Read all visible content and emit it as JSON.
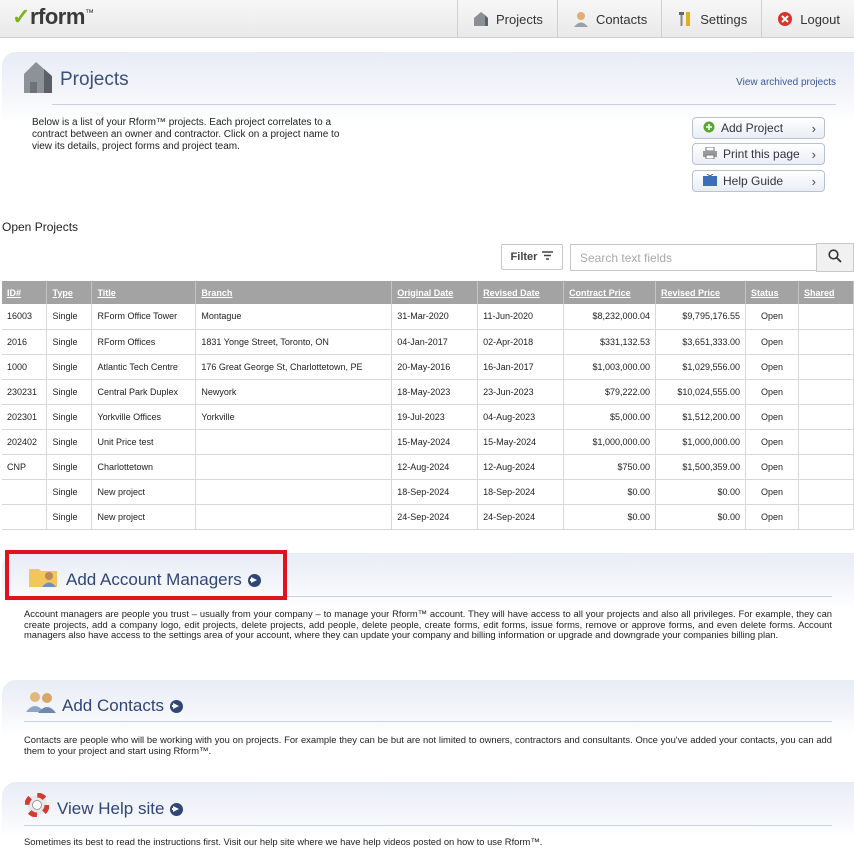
{
  "app": {
    "logo_text": "rform",
    "logo_tm": "™"
  },
  "nav": [
    {
      "label": "Projects",
      "icon": "house-icon"
    },
    {
      "label": "Contacts",
      "icon": "person-icon"
    },
    {
      "label": "Settings",
      "icon": "tools-icon"
    },
    {
      "label": "Logout",
      "icon": "logout-icon"
    }
  ],
  "projects_panel": {
    "title": "Projects",
    "archived_link": "View archived projects",
    "description": "Below is a list of your Rform™ projects. Each project correlates to a contract between an owner and contractor. Click on a project name to view its details, project forms and project team.",
    "buttons": {
      "add_project": "Add Project",
      "print_page": "Print this page",
      "help_guide": "Help Guide"
    }
  },
  "open_projects_label": "Open Projects",
  "filter": {
    "label": "Filter"
  },
  "search": {
    "placeholder": "Search text fields"
  },
  "table": {
    "headers": [
      "ID#",
      "Type",
      "Title",
      "Branch",
      "Original Date",
      "Revised Date",
      "Contract Price",
      "Revised Price",
      "Status",
      "Shared"
    ],
    "rows": [
      [
        "16003",
        "Single",
        "RForm Office Tower",
        "Montague",
        "31-Mar-2020",
        "11-Jun-2020",
        "$8,232,000.04",
        "$9,795,176.55",
        "Open",
        ""
      ],
      [
        "2016",
        "Single",
        "RForm Offices",
        "1831 Yonge Street, Toronto, ON",
        "04-Jan-2017",
        "02-Apr-2018",
        "$331,132.53",
        "$3,651,333.00",
        "Open",
        ""
      ],
      [
        "1000",
        "Single",
        "Atlantic Tech Centre",
        "176 Great George St, Charlottetown, PE",
        "20-May-2016",
        "16-Jan-2017",
        "$1,003,000.00",
        "$1,029,556.00",
        "Open",
        ""
      ],
      [
        "230231",
        "Single",
        "Central Park Duplex",
        "Newyork",
        "18-May-2023",
        "23-Jun-2023",
        "$79,222.00",
        "$10,024,555.00",
        "Open",
        ""
      ],
      [
        "202301",
        "Single",
        "Yorkville Offices",
        "Yorkville",
        "19-Jul-2023",
        "04-Aug-2023",
        "$5,000.00",
        "$1,512,200.00",
        "Open",
        ""
      ],
      [
        "202402",
        "Single",
        "Unit Price test",
        "",
        "15-May-2024",
        "15-May-2024",
        "$1,000,000.00",
        "$1,000,000.00",
        "Open",
        ""
      ],
      [
        "CNP",
        "Single",
        "Charlottetown",
        "",
        "12-Aug-2024",
        "12-Aug-2024",
        "$750.00",
        "$1,500,359.00",
        "Open",
        ""
      ],
      [
        "",
        "Single",
        "New project",
        "",
        "18-Sep-2024",
        "18-Sep-2024",
        "$0.00",
        "$0.00",
        "Open",
        ""
      ],
      [
        "",
        "Single",
        "New project",
        "",
        "24-Sep-2024",
        "24-Sep-2024",
        "$0.00",
        "$0.00",
        "Open",
        ""
      ]
    ]
  },
  "account_managers": {
    "title": "Add Account Managers",
    "description": "Account managers are people you trust – usually from your company – to manage your Rform™ account. They will have access to all your projects and also all privileges. For example, they can create projects, add a company logo, edit projects, delete projects, add people, delete people, create forms, edit forms, issue forms, remove or approve forms, and even delete forms. Account managers also have access to the settings area of your account, where they can update your company and billing information or upgrade and downgrade your companies billing plan."
  },
  "contacts": {
    "title": "Add Contacts",
    "description": "Contacts are people who will be working with you on projects. For example they can be but are not limited to owners, contractors and consultants. Once you've added your contacts, you can add them to your project and start using Rform™."
  },
  "help_site": {
    "title": "View Help site",
    "description": "Sometimes its best to read the instructions first. Visit our help site where we have help videos posted on how to use Rform™."
  },
  "colors": {
    "highlight": "#e0131a",
    "title_blue": "#2f4677",
    "header_gray": "#a3a3a3"
  }
}
